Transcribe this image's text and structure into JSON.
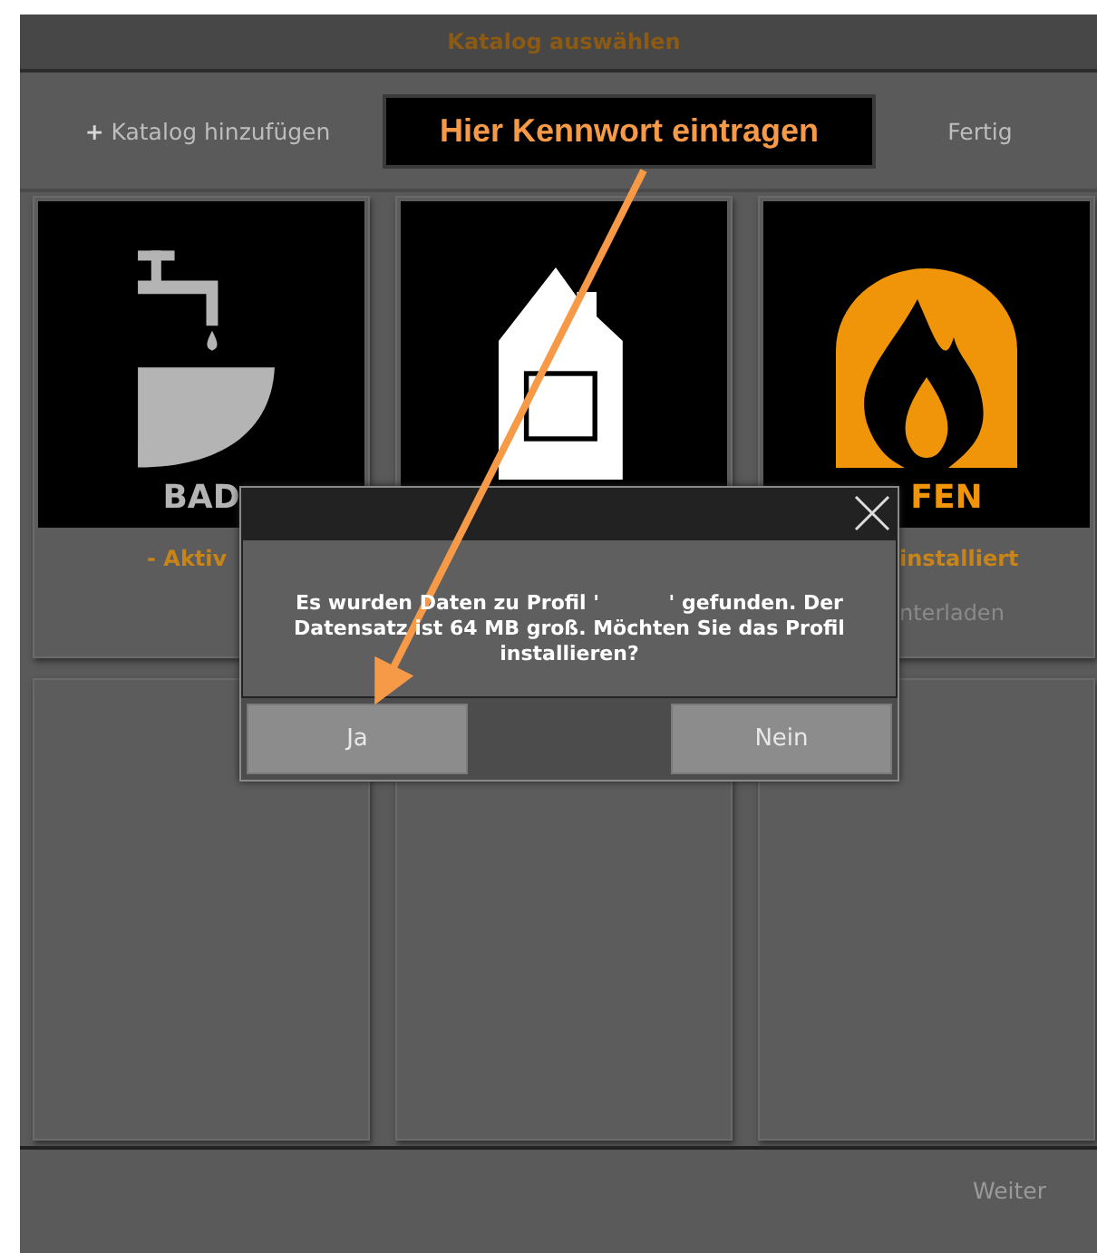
{
  "window": {
    "title": "Katalog auswählen"
  },
  "toolbar": {
    "add_button": {
      "icon": "+",
      "label": "Katalog hinzufügen"
    },
    "done_button": "Fertig"
  },
  "annotation": {
    "callout": "Hier Kennwort eintragen"
  },
  "catalogs": [
    {
      "kind": "bath",
      "label": "BAD",
      "status": "- Aktiv"
    },
    {
      "kind": "house"
    },
    {
      "kind": "stove",
      "label": "FEN",
      "status": "installiert",
      "action": "nterladen"
    },
    {
      "kind": "empty"
    },
    {
      "kind": "empty"
    },
    {
      "kind": "empty"
    }
  ],
  "dialog": {
    "message": "Es wurden Daten zu Profil '          ' gefunden. Der Datensatz ist 64 MB groß. Möchten Sie das Profil installieren?",
    "buttons": [
      "Ja",
      "Nein"
    ]
  },
  "footer": {
    "next_button": "Weiter"
  }
}
